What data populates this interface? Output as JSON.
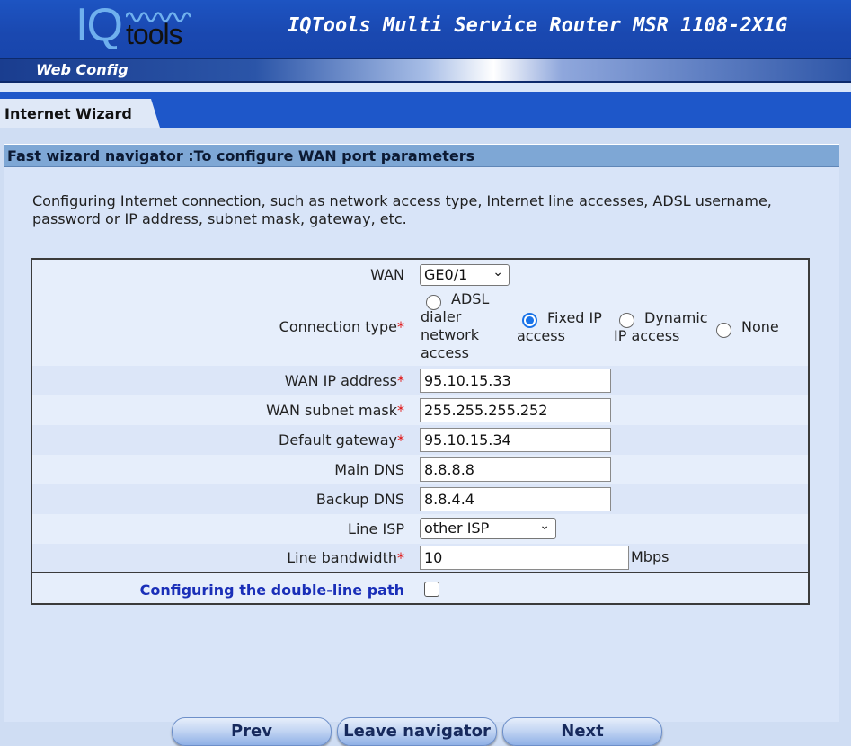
{
  "header": {
    "logo_iq": "IQ",
    "logo_tools": "tools",
    "product_title": "IQTools Multi Service Router MSR 1108-2X1G",
    "web_config": "Web Config"
  },
  "tabs": [
    {
      "label": "Internet Wizard",
      "active": true
    }
  ],
  "section": {
    "title": "Fast wizard navigator :To configure WAN port parameters",
    "description": "Configuring Internet connection, such as network access type, Internet line accesses, ADSL username, password or IP address, subnet mask, gateway, etc."
  },
  "form": {
    "wan": {
      "label": "WAN",
      "value": "GE0/1"
    },
    "connection_type": {
      "label": "Connection type",
      "options": [
        {
          "line1": "ADSL",
          "line2": "dialer",
          "line3": "network",
          "line4": "access",
          "selected": false
        },
        {
          "line1": "Fixed IP",
          "line2": "access",
          "selected": true
        },
        {
          "line1": "Dynamic",
          "line2": "IP access",
          "selected": false
        },
        {
          "line1": "None",
          "selected": false
        }
      ]
    },
    "wan_ip": {
      "label": "WAN IP address",
      "value": "95.10.15.33"
    },
    "wan_mask": {
      "label": "WAN subnet mask",
      "value": "255.255.255.252"
    },
    "gateway": {
      "label": "Default gateway",
      "value": "95.10.15.34"
    },
    "main_dns": {
      "label": "Main DNS",
      "value": "8.8.8.8"
    },
    "backup_dns": {
      "label": "Backup DNS",
      "value": "8.8.4.4"
    },
    "line_isp": {
      "label": "Line ISP",
      "value": "other ISP"
    },
    "bandwidth": {
      "label": "Line bandwidth",
      "value": "10",
      "unit": "Mbps"
    },
    "double_line": {
      "label": "Configuring the double-line path",
      "checked": false
    },
    "required_mark": "*"
  },
  "buttons": {
    "prev": "Prev",
    "leave": "Leave navigator",
    "next": "Next"
  },
  "colors": {
    "header_blue": "#1d54c2",
    "section_header": "#7ea7d5",
    "link_blue": "#1a2fb8",
    "required_red": "#e01010"
  }
}
